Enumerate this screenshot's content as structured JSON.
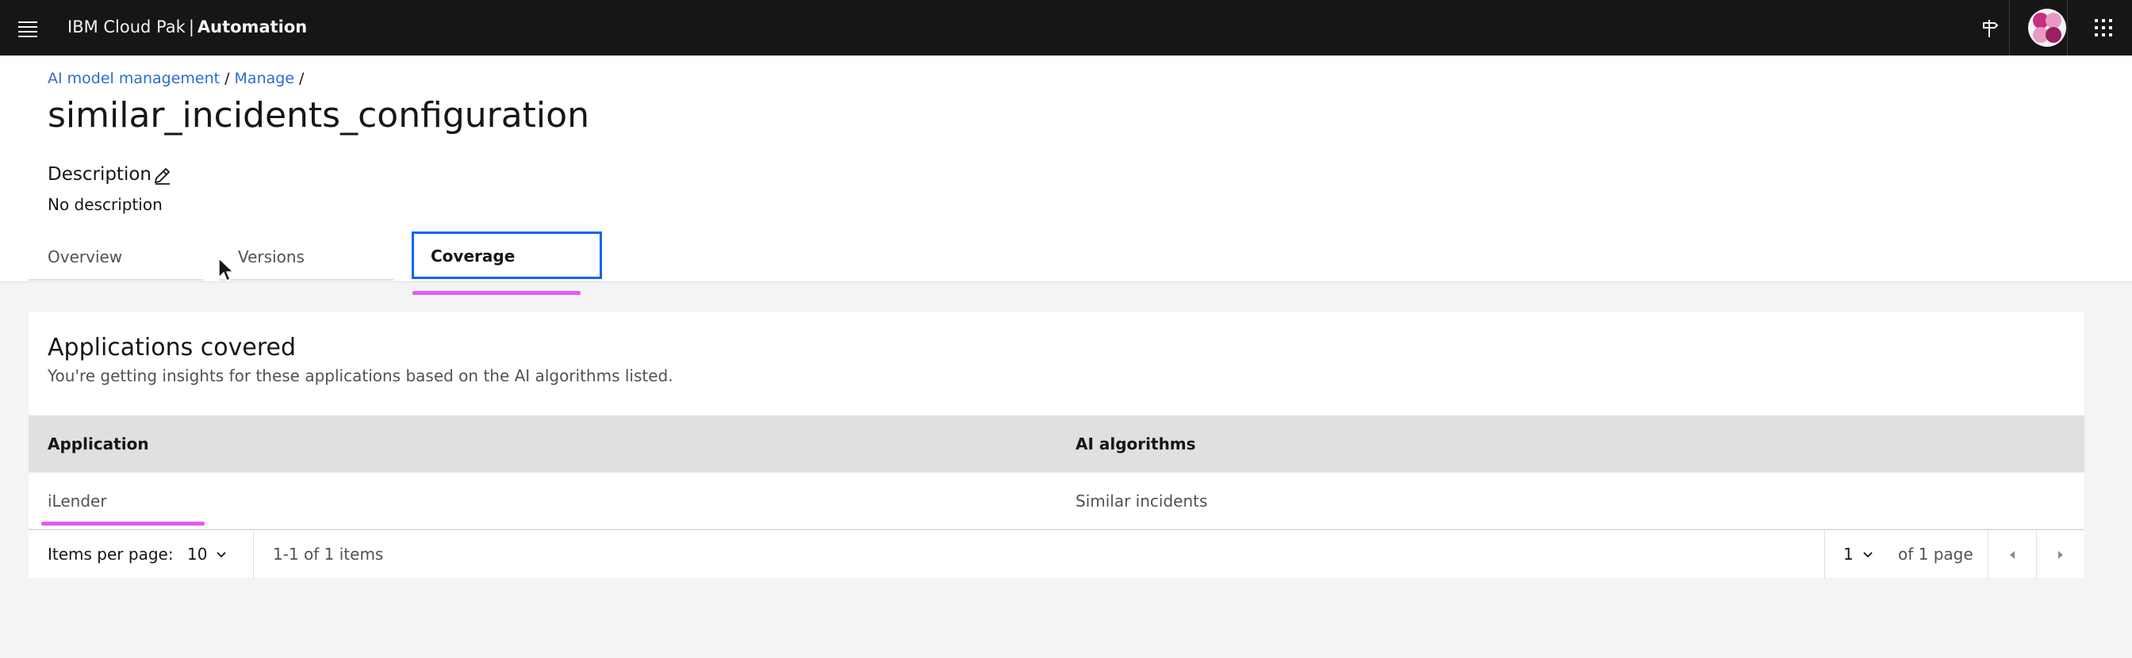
{
  "header": {
    "brand_prefix": "IBM Cloud Pak",
    "brand_separator": "|",
    "brand_product": "Automation",
    "icons": [
      "menu-icon",
      "signpost-icon",
      "user-avatar",
      "app-switcher-icon"
    ]
  },
  "breadcrumb": {
    "items": [
      "AI model management",
      "Manage"
    ],
    "separator": "/"
  },
  "page": {
    "title": "similar_incidents_configuration",
    "description_label": "Description",
    "description_value": "No description"
  },
  "tabs": [
    {
      "label": "Overview",
      "selected": false
    },
    {
      "label": "Versions",
      "selected": false
    },
    {
      "label": "Coverage",
      "selected": true
    }
  ],
  "coverage": {
    "title": "Applications covered",
    "subtitle": "You're getting insights for these applications based on the AI algorithms listed.",
    "columns": [
      "Application",
      "AI algorithms"
    ],
    "rows": [
      [
        "iLender",
        "Similar incidents"
      ]
    ],
    "pagination": {
      "items_per_page_label": "Items per page:",
      "items_per_page_value": "10",
      "range_text": "1-1 of 1 items",
      "page_value": "1",
      "page_total_text": "of 1 page"
    }
  },
  "colors": {
    "header_bg": "#161616",
    "link": "#2e6bd1",
    "focus": "#0f62fe",
    "highlight": "#e35df0",
    "table_header_bg": "#e0e0e0",
    "page_bg": "#f4f4f4"
  }
}
